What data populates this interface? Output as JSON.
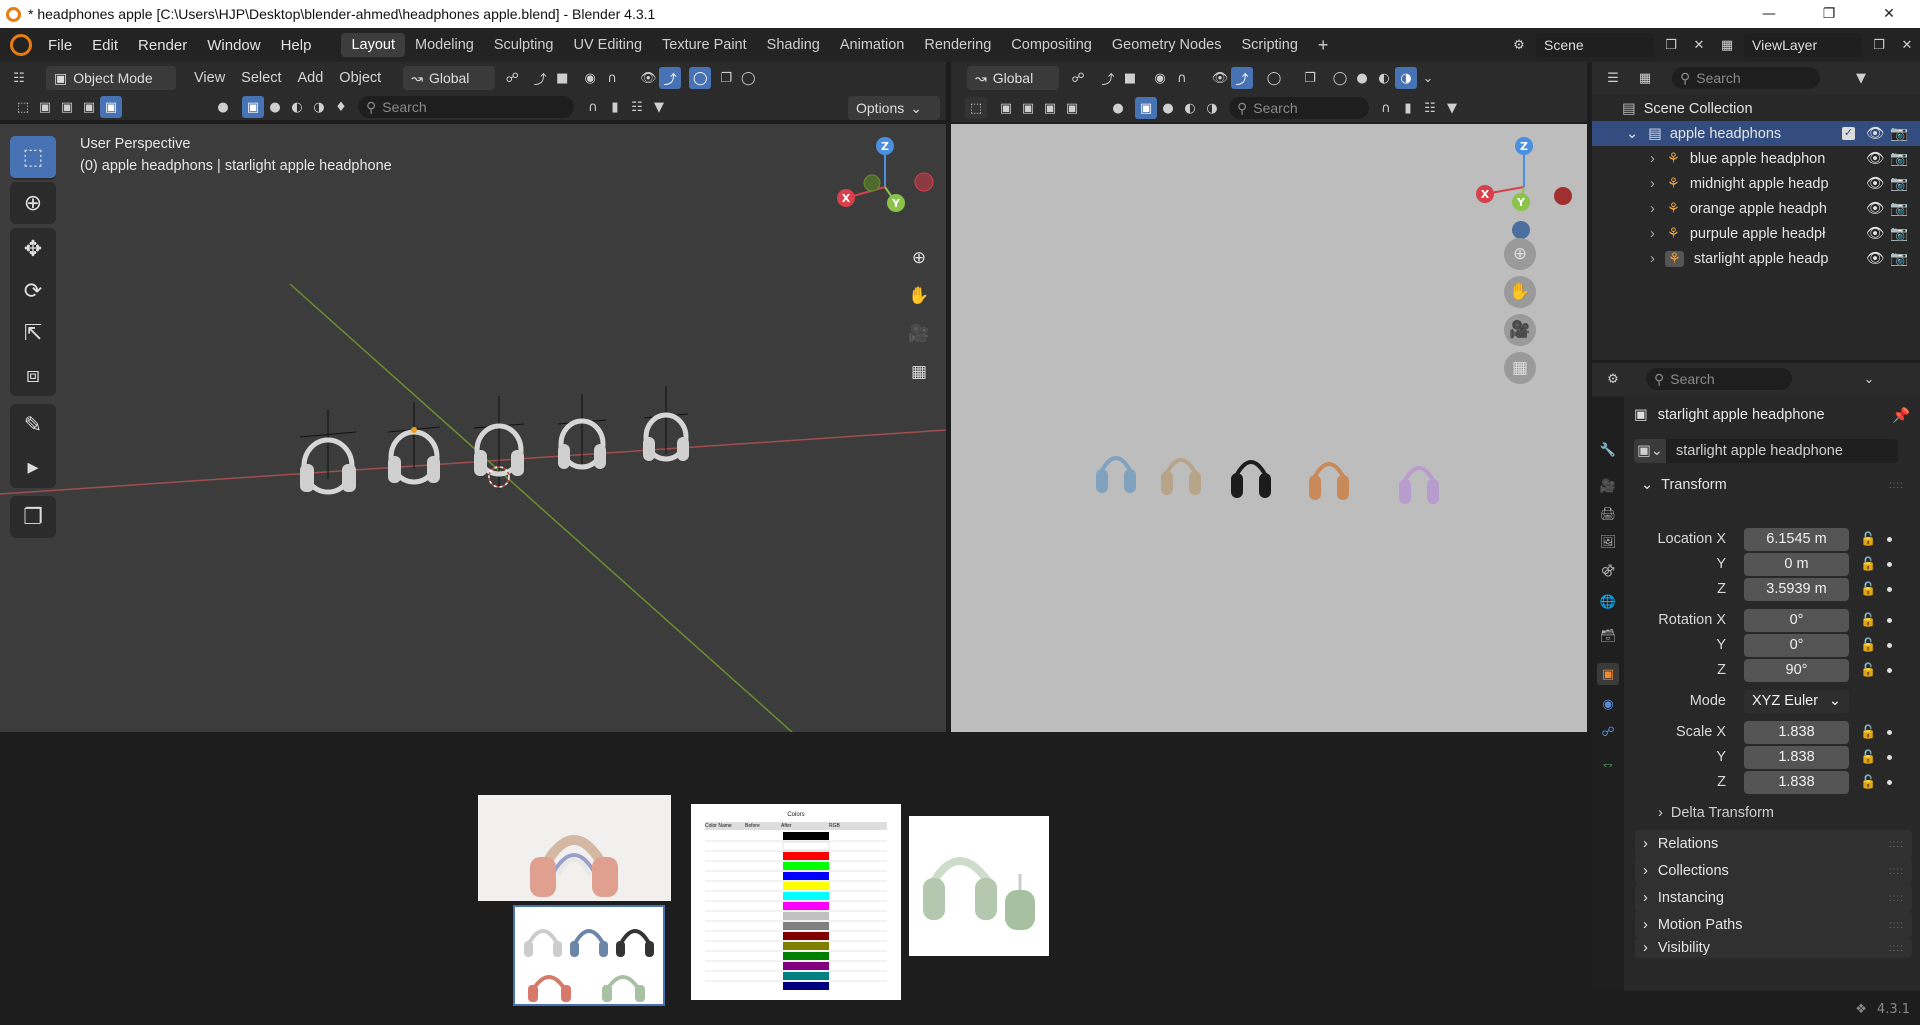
{
  "window": {
    "title": "* headphones apple [C:\\Users\\HJP\\Desktop\\blender-ahmed\\headphones apple.blend] - Blender 4.3.1",
    "minimize": "—",
    "maximize": "❐",
    "close": "✕"
  },
  "menu": [
    "File",
    "Edit",
    "Render",
    "Window",
    "Help"
  ],
  "workspaces": [
    "Layout",
    "Modeling",
    "Sculpting",
    "UV Editing",
    "Texture Paint",
    "Shading",
    "Animation",
    "Rendering",
    "Compositing",
    "Geometry Nodes",
    "Scripting"
  ],
  "workspaces_active": "Layout",
  "scene": {
    "label": "Scene",
    "viewlayer": "ViewLayer"
  },
  "viewport_left": {
    "mode": "Object Mode",
    "menus": [
      "View",
      "Select",
      "Add",
      "Object"
    ],
    "orientation": "Global",
    "search_placeholder": "Search",
    "options": "Options",
    "perspective": "User Perspective",
    "active_info": "(0) apple headphons | starlight apple headphone"
  },
  "viewport_right": {
    "orientation": "Global",
    "search_placeholder": "Search"
  },
  "gizmo": {
    "x": "X",
    "y": "Y",
    "z": "Z"
  },
  "outliner": {
    "search_placeholder": "Search",
    "scene_collection": "Scene Collection",
    "collection": "apple headphons",
    "items": [
      "blue apple headphon",
      "midnight apple headp",
      "orange apple headph",
      "purpule apple headpł",
      "starlight apple headp"
    ]
  },
  "properties": {
    "search_placeholder": "Search",
    "object_name": "starlight apple headphone",
    "datablock_name": "starlight apple headphone",
    "transform_header": "Transform",
    "location_label": "Location X",
    "location": {
      "x": "6.1545 m",
      "y": "0 m",
      "z": "3.5939 m"
    },
    "rotation_label": "Rotation X",
    "rotation": {
      "x": "0°",
      "y": "0°",
      "z": "90°"
    },
    "mode_label": "Mode",
    "mode_value": "XYZ Euler",
    "scale_label": "Scale X",
    "scale": {
      "x": "1.838",
      "y": "1.838",
      "z": "1.838"
    },
    "y_label": "Y",
    "z_label": "Z",
    "delta_transform": "Delta Transform",
    "panels": [
      "Relations",
      "Collections",
      "Instancing",
      "Motion Paths",
      "Visibility"
    ]
  },
  "reference": {
    "table_title": "Colors",
    "table_headers": [
      "Color Name",
      "Before",
      "After",
      "RGB"
    ]
  },
  "status": {
    "version": "4.3.1"
  },
  "colors": {
    "accent": "#4772b3",
    "x_axis": "#d8404b",
    "y_axis": "#8bc34a",
    "z_axis": "#4a8fe0",
    "headphones_right": [
      "#7fa3bf",
      "#b8a489",
      "#1c1c1c",
      "#c98a5a",
      "#b79ccd"
    ]
  }
}
